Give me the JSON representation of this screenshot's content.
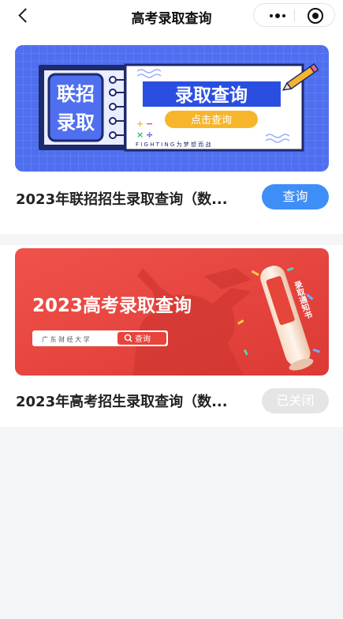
{
  "nav": {
    "title": "高考录取查询"
  },
  "cards": [
    {
      "banner": {
        "badge_line1": "联招",
        "badge_line2": "录取",
        "headline": "录取查询",
        "cta": "点击查询",
        "slogan": "F I G H T I N G 为 梦 想 而 战",
        "colors": {
          "background": "#4f6ff0",
          "accent": "#f7b52c"
        }
      },
      "title": "2023年联招招生录取查询（数...",
      "button": "查询"
    },
    {
      "banner": {
        "headline": "2023高考录取查询",
        "search_placeholder": "广 东 财 经 大 学",
        "search_button": "查询",
        "scroll_text": "录取通知书",
        "colors": {
          "background": "#e8443c"
        }
      },
      "title": "2023年高考招生录取查询（数...",
      "button": "已关闭"
    }
  ]
}
